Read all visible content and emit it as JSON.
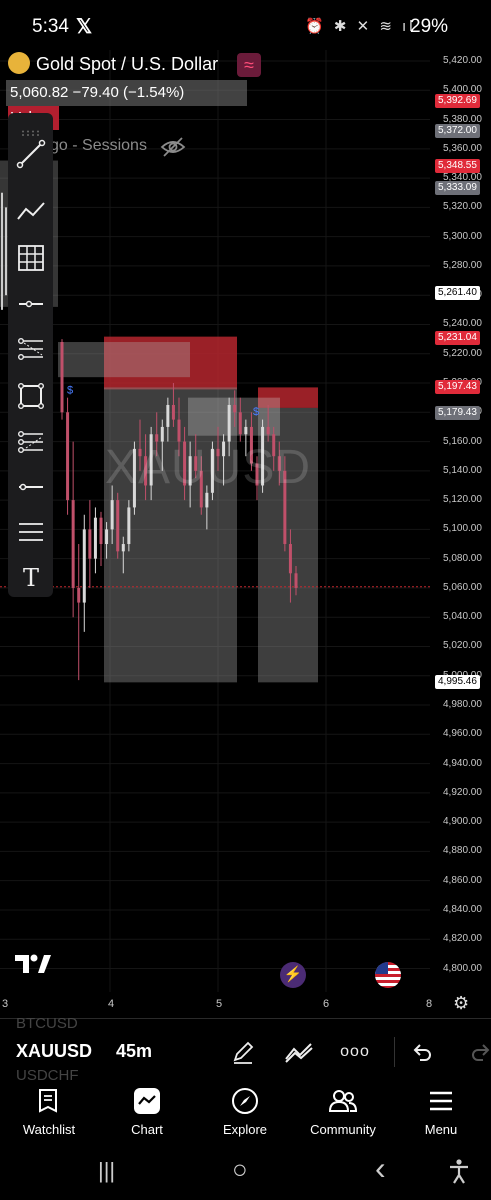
{
  "status_bar": {
    "time": "5:34",
    "x_logo": "𝕏",
    "icons": "⏰ ✱ ✕ ≋ ıl",
    "battery": "29%"
  },
  "chart": {
    "symbol_title": "Gold Spot / U.S. Dollar",
    "price_line": "5,060.82  −79.40 (−1.54%)",
    "vol_label": "Vol",
    "indicator_label": "go - Sessions",
    "watermark": "XAUUSD",
    "y_ticks": [
      "5,420.00",
      "5,400.00",
      "5,380.00",
      "5,360.00",
      "5,340.00",
      "5,320.00",
      "5,300.00",
      "5,280.00",
      "5,260.00",
      "5,240.00",
      "5,220.00",
      "5,200.00",
      "5,180.00",
      "5,160.00",
      "5,140.00",
      "5,120.00",
      "5,100.00",
      "5,080.00",
      "5,060.00",
      "5,040.00",
      "5,020.00",
      "5,000.00",
      "4,980.00",
      "4,960.00",
      "4,940.00",
      "4,920.00",
      "4,900.00",
      "4,880.00",
      "4,860.00",
      "4,840.00",
      "4,820.00",
      "4,800.00"
    ],
    "price_labels": [
      {
        "text": "5,392.69",
        "bg": "#e02b3a",
        "fg": "#ffffff"
      },
      {
        "text": "5,372.00",
        "bg": "#6e7078",
        "fg": "#ffffff"
      },
      {
        "text": "5,348.55",
        "bg": "#e02b3a",
        "fg": "#ffffff"
      },
      {
        "text": "5,333.09",
        "bg": "#6e7078",
        "fg": "#ffffff"
      },
      {
        "text": "5,261.40",
        "bg": "#ffffff",
        "fg": "#000000"
      },
      {
        "text": "5,231.04",
        "bg": "#e02b3a",
        "fg": "#ffffff"
      },
      {
        "text": "5,197.43",
        "bg": "#e02b3a",
        "fg": "#ffffff"
      },
      {
        "text": "5,179.43",
        "bg": "#6e7078",
        "fg": "#ffffff"
      },
      {
        "text": "4,995.46",
        "bg": "#ffffff",
        "fg": "#000000"
      }
    ],
    "x_ticks": [
      "3",
      "4",
      "5",
      "6",
      "8"
    ],
    "dollar_markers": [
      "$",
      "$"
    ],
    "colors": {
      "up": "#d9d9d9",
      "down": "#c0506a",
      "zone_red": "#c1272d",
      "zone_grey": "#8a8a8a",
      "current_price_line": "#c1272d"
    }
  },
  "toolbar": {
    "tools": [
      "trend-line-icon",
      "multi-point-line-icon",
      "grid-icon",
      "horizontal-ray-icon",
      "fib-retracement-icon",
      "rectangle-icon",
      "pitchfork-icon",
      "horizontal-line-icon",
      "parallel-lines-icon",
      "text-tool-icon"
    ],
    "text_tool_glyph": "T"
  },
  "symbol_bar": {
    "ghost_above": "BTCUSD",
    "ghost_below": "USDCHF",
    "symbol": "XAUUSD",
    "interval": "45m",
    "more_glyph": "ooo"
  },
  "bottom_nav": {
    "items": [
      {
        "label": "Watchlist",
        "icon": "watchlist-icon"
      },
      {
        "label": "Chart",
        "icon": "chart-icon"
      },
      {
        "label": "Explore",
        "icon": "compass-icon"
      },
      {
        "label": "Community",
        "icon": "community-icon"
      },
      {
        "label": "Menu",
        "icon": "menu-icon"
      }
    ]
  },
  "system_nav": {
    "recents": "|||",
    "home": "○",
    "back": "‹"
  }
}
